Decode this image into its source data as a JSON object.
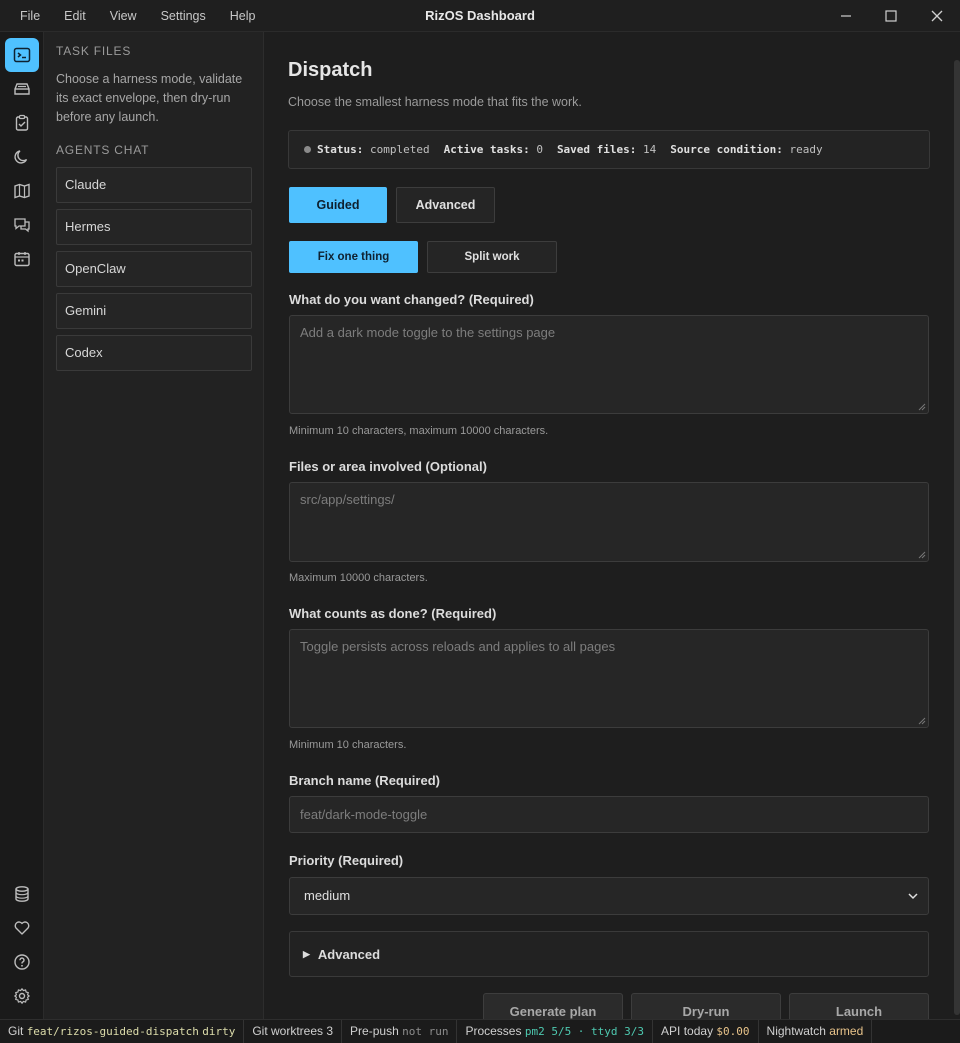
{
  "window": {
    "title": "RizOS Dashboard"
  },
  "menu": [
    "File",
    "Edit",
    "View",
    "Settings",
    "Help"
  ],
  "activity_bar": {
    "top": [
      "terminal-icon",
      "layers-icon",
      "clipboard-check-icon",
      "moon-icon",
      "map-icon",
      "chat-icon",
      "calendar-icon"
    ],
    "bottom": [
      "database-icon",
      "heart-icon",
      "help-icon",
      "gear-icon"
    ],
    "active": "terminal-icon"
  },
  "sidebar": {
    "task_files_heading": "TASK FILES",
    "task_files_description": "Choose a harness mode, validate its exact envelope, then dry-run before any launch.",
    "agents_heading": "AGENTS CHAT",
    "agents": [
      "Claude",
      "Hermes",
      "OpenClaw",
      "Gemini",
      "Codex"
    ]
  },
  "main": {
    "title": "Dispatch",
    "subtitle": "Choose the smallest harness mode that fits the work.",
    "status": {
      "status_label": "Status:",
      "status_value": "completed",
      "active_label": "Active tasks:",
      "active_value": "0",
      "saved_label": "Saved files:",
      "saved_value": "14",
      "source_label": "Source condition:",
      "source_value": "ready"
    },
    "mode_tabs": {
      "guided": "Guided",
      "advanced": "Advanced",
      "selected": "guided"
    },
    "work_tabs": {
      "fix": "Fix one thing",
      "split": "Split work",
      "selected": "fix"
    },
    "fields": {
      "change": {
        "label": "What do you want changed? (Required)",
        "placeholder": "Add a dark mode toggle to the settings page",
        "hint": "Minimum 10 characters, maximum 10000 characters."
      },
      "files": {
        "label": "Files or area involved (Optional)",
        "placeholder": "src/app/settings/",
        "hint": "Maximum 10000 characters."
      },
      "done": {
        "label": "What counts as done? (Required)",
        "placeholder": "Toggle persists across reloads and applies to all pages",
        "hint": "Minimum 10 characters."
      },
      "branch": {
        "label": "Branch name (Required)",
        "placeholder": "feat/dark-mode-toggle"
      },
      "priority": {
        "label": "Priority (Required)",
        "value": "medium"
      }
    },
    "advanced_section": "Advanced",
    "actions": {
      "generate": "Generate plan",
      "dryrun": "Dry-run",
      "launch": "Launch"
    }
  },
  "statusbar": {
    "git_label": "Git",
    "git_branch": "feat/rizos-guided-dispatch",
    "git_state": "dirty",
    "worktrees": "Git worktrees 3",
    "prepush_label": "Pre-push",
    "prepush_value": "not run",
    "processes_label": "Processes",
    "processes_value": "pm2 5/5 · ttyd 3/3",
    "api_label": "API today",
    "api_value": "$0.00",
    "nightwatch_label": "Nightwatch",
    "nightwatch_value": "armed"
  },
  "colors": {
    "accent": "#4fc1ff",
    "background": "#1e1e1e",
    "sidebar": "#222222"
  }
}
